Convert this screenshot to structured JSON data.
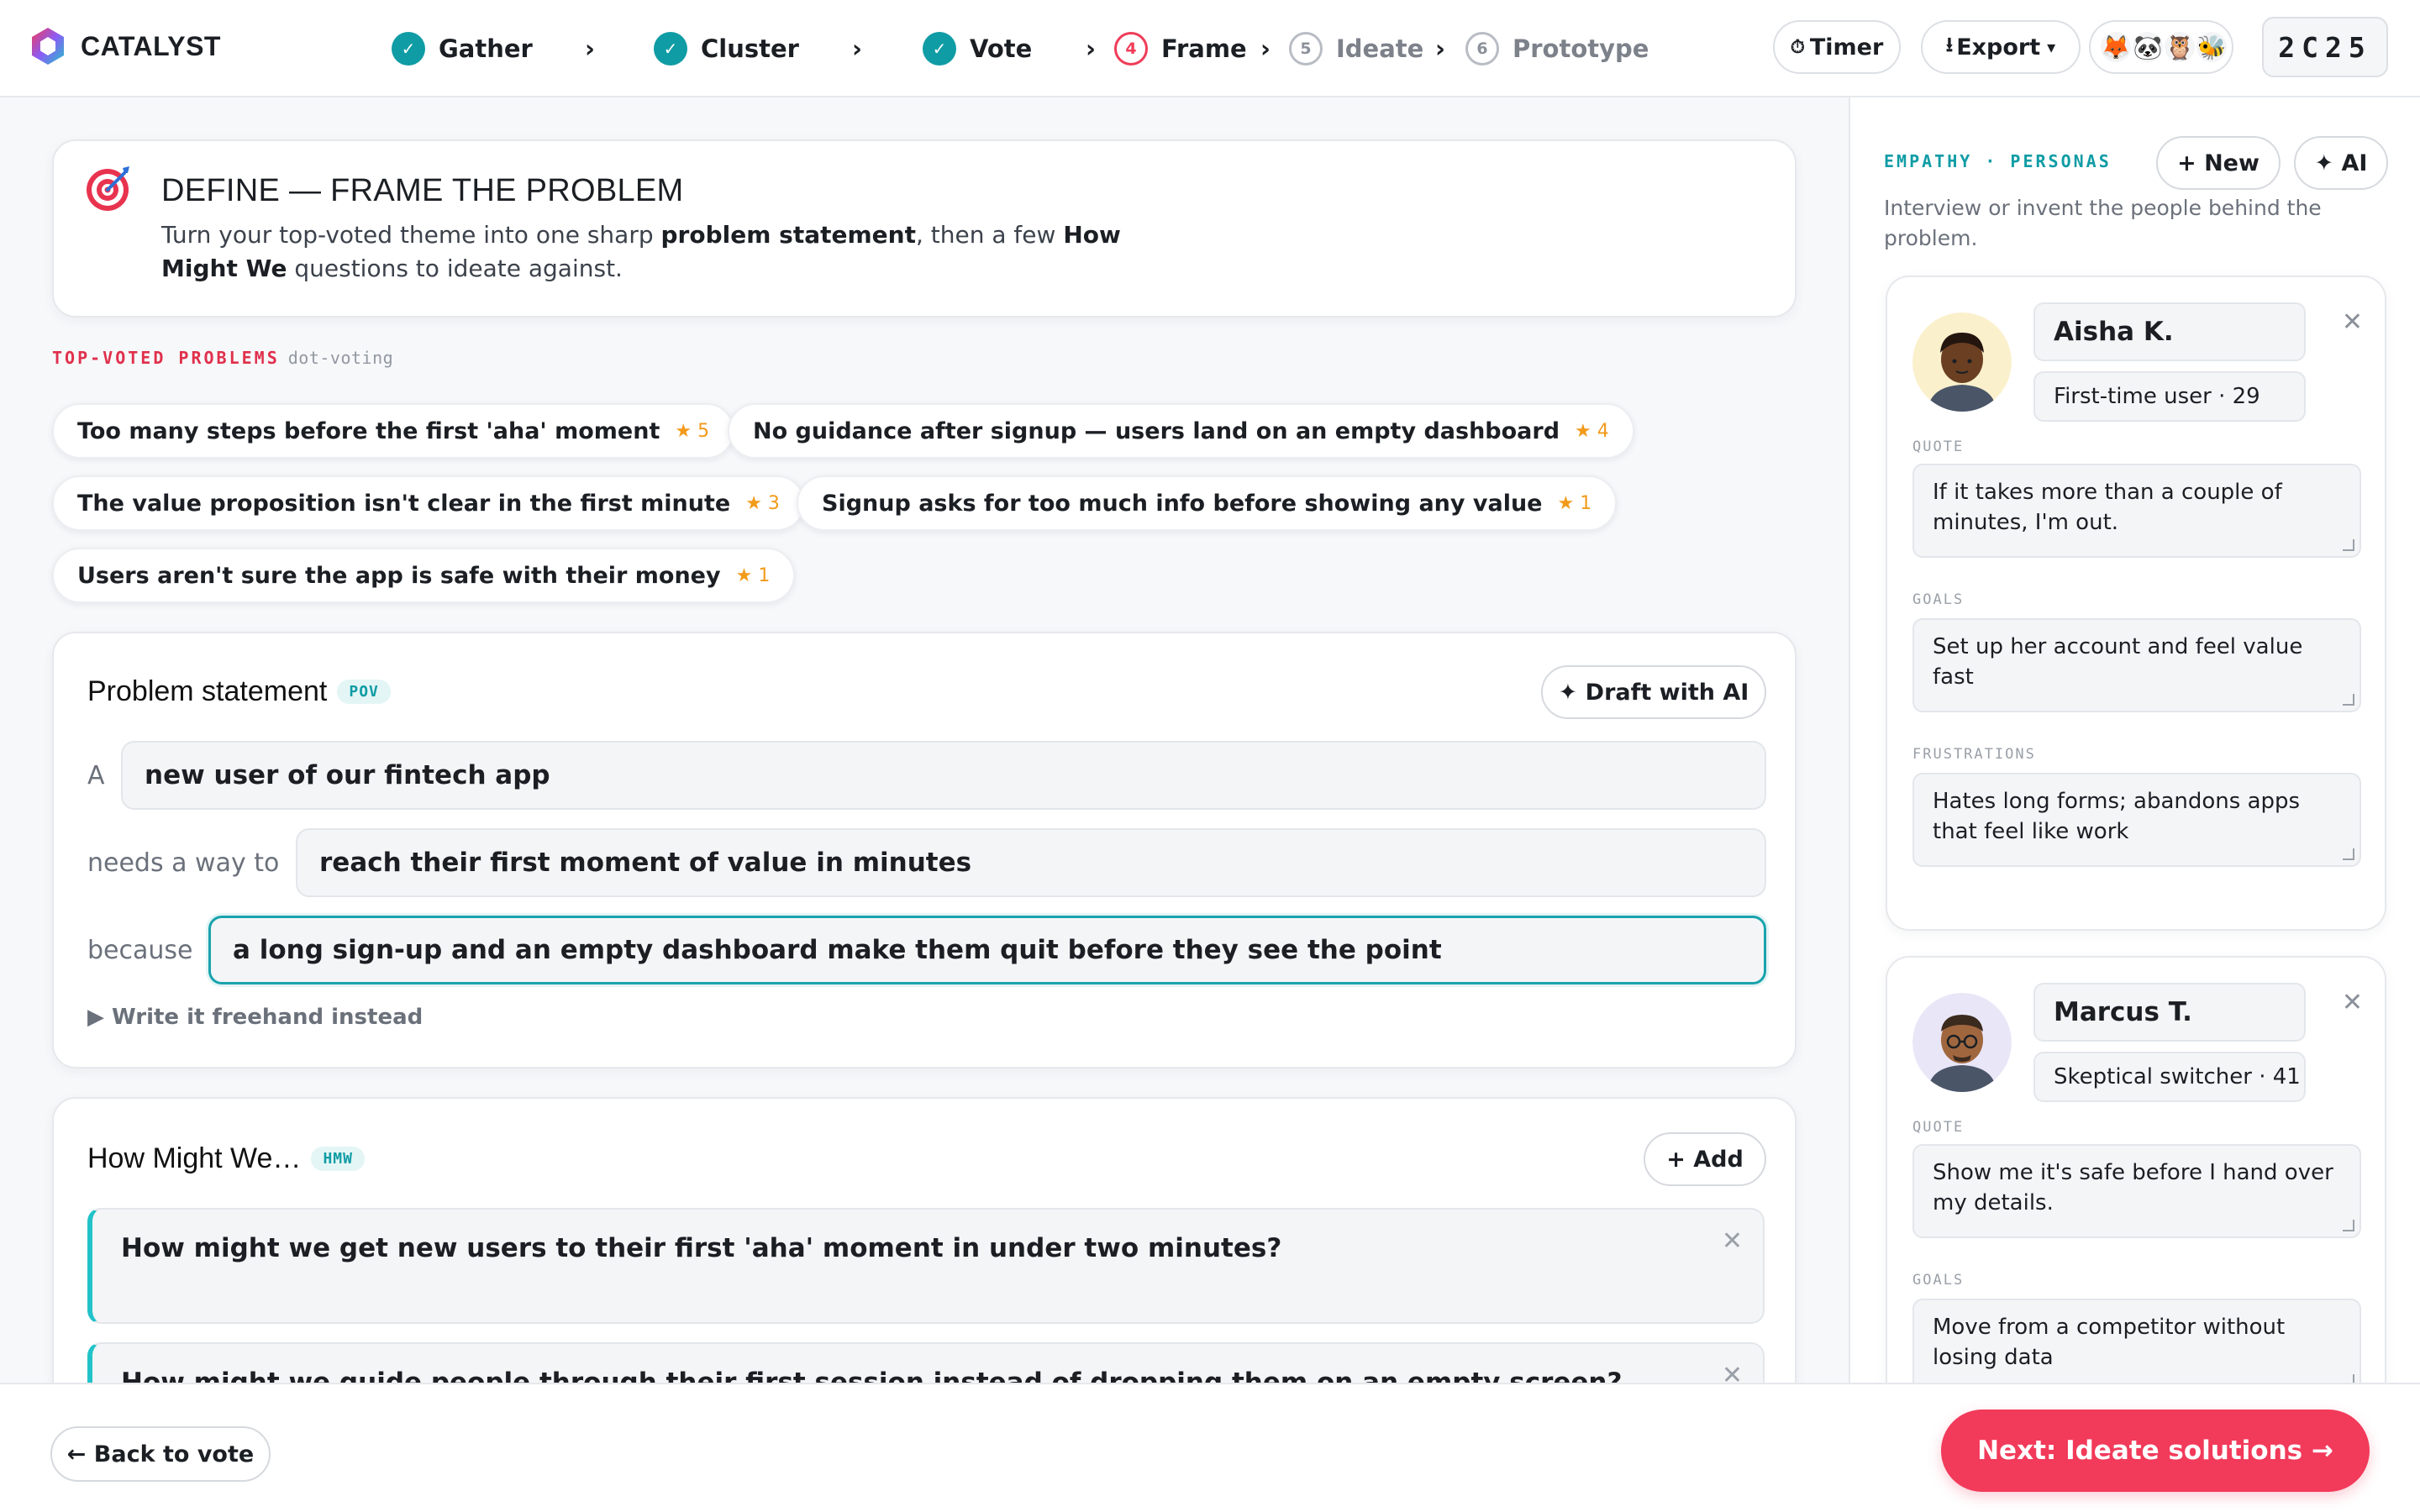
{
  "app": {
    "name": "CATALYST"
  },
  "steps": [
    {
      "num": "✓",
      "label": "Gather",
      "state": "done"
    },
    {
      "num": "✓",
      "label": "Cluster",
      "state": "done"
    },
    {
      "num": "✓",
      "label": "Vote",
      "state": "done"
    },
    {
      "num": "4",
      "label": "Frame",
      "state": "current"
    },
    {
      "num": "5",
      "label": "Ideate",
      "state": "todo"
    },
    {
      "num": "6",
      "label": "Prototype",
      "state": "todo"
    }
  ],
  "toolbar": {
    "timer_icon": "⏱",
    "timer_label": "Timer",
    "export_icon": "⭳",
    "export_label": "Export",
    "export_caret": "▾",
    "participants": [
      "🦊",
      "🐼",
      "🦉",
      "🐝"
    ],
    "room_code": "2C25"
  },
  "define": {
    "title": "DEFINE — FRAME THE PROBLEM",
    "desc_1": "Turn your top-voted theme into one sharp ",
    "desc_b1": "problem statement",
    "desc_2": ", then a few ",
    "desc_b2": "How Might We",
    "desc_3": " questions to ideate against."
  },
  "top_voted": {
    "label": "TOP-VOTED PROBLEMS",
    "sub": "dot-voting",
    "star": "★",
    "items": [
      {
        "text": "Too many steps before the first 'aha' moment",
        "votes": "5"
      },
      {
        "text": "No guidance after signup — users land on an empty dashboard",
        "votes": "4"
      },
      {
        "text": "The value proposition isn't clear in the first minute",
        "votes": "3"
      },
      {
        "text": "Signup asks for too much info before showing any value",
        "votes": "1"
      },
      {
        "text": "Users aren't sure the app is safe with their money",
        "votes": "1"
      }
    ]
  },
  "problem": {
    "title": "Problem statement",
    "tag": "POV",
    "draft_label": "✦ Draft with AI",
    "lbl_a": "A",
    "val_a": "new user of our fintech app",
    "lbl_needs": "needs a way to",
    "val_needs": "reach their first moment of value in minutes",
    "lbl_because": "because",
    "val_because": "a long sign-up and an empty dashboard make them quit before they see the point",
    "freehand": "▶ Write it freehand instead"
  },
  "hmw": {
    "title": "How Might We…",
    "tag": "HMW",
    "add_label": "+ Add",
    "close": "✕",
    "items": [
      "How might we get new users to their first 'aha' moment in under two minutes?",
      "How might we guide people through their first session instead of dropping them on an empty screen?"
    ]
  },
  "personas_panel": {
    "label": "EMPATHY · PERSONAS",
    "new_label": "+ New",
    "ai_label": "✦ AI",
    "desc": "Interview or invent the people behind the problem.",
    "quote_label": "QUOTE",
    "goals_label": "GOALS",
    "frustrations_label": "FRUSTRATIONS",
    "close": "✕",
    "personas": [
      {
        "name": "Aisha K.",
        "role": "First-time user · 29",
        "quote": "If it takes more than a couple of minutes, I'm out.",
        "goals": "Set up her account and feel value fast",
        "frustrations": "Hates long forms; abandons apps that feel like work"
      },
      {
        "name": "Marcus T.",
        "role": "Skeptical switcher · 41",
        "quote": "Show me it's safe before I hand over my details.",
        "goals": "Move from a competitor without losing data"
      }
    ]
  },
  "footer": {
    "back_label": "← Back to vote",
    "next_label": "Next: Ideate solutions →"
  },
  "colors": {
    "accent": "#f23a5a",
    "teal": "#0f9ca5",
    "star": "#f29a1a"
  }
}
